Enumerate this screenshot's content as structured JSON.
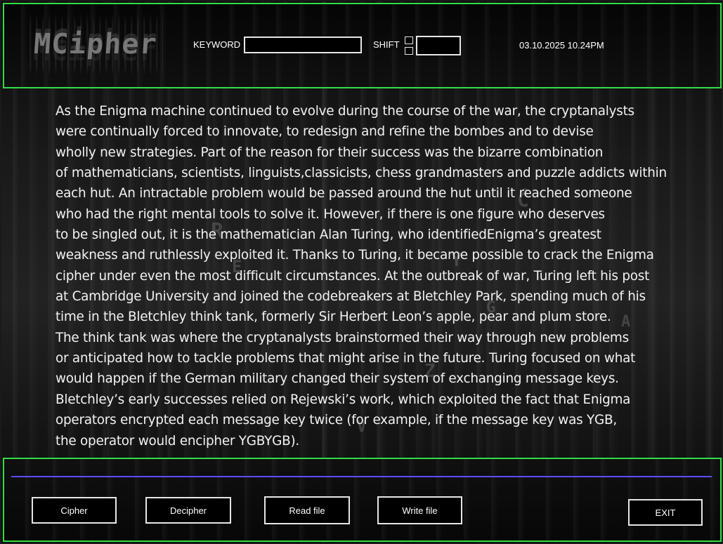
{
  "header": {
    "logo_text": "MCipher",
    "keyword_label": "KEYWORD",
    "keyword_value": "",
    "shift_label": "SHIFT",
    "shift_value": "",
    "datetime": "03.10.2025 10.24PM"
  },
  "main": {
    "lines": [
      "As the Enigma machine continued to evolve during the course of the war, the cryptanalysts",
      "were continually forced to innovate, to redesign and refine the bombes and to devise",
      "wholly new strategies. Part of the reason for their success was the bizarre combination",
      "of mathematicians, scientists, linguists,classicists, chess grandmasters and puzzle addicts within",
      "each hut. An intractable problem would be passed around the hut until it reached someone",
      "who had the right mental tools to solve it. However, if there is one figure who deserves",
      "to be singled out, it is the mathematician Alan Turing, who identifiedEnigma’s greatest",
      "weakness and ruthlessly exploited it. Thanks to Turing, it became possible to crack the Enigma",
      "cipher under even the most difficult circumstances. At the outbreak of war, Turing left his post",
      "at Cambridge University and joined the codebreakers at Bletchley Park, spending much of his",
      "time in the Bletchley think tank, formerly Sir Herbert Leon’s apple, pear and plum store.",
      "The think tank was where the cryptanalysts brainstormed their way through new problems",
      "or anticipated how to tackle problems that might arise in the future. Turing focused on what",
      "would happen if the German military changed their system of exchanging message keys.",
      "Bletchley’s early successes relied on Rejewski’s work, which exploited the fact that Enigma",
      "operators encrypted each message key twice (for example, if the message key was YGB,",
      "the operator would encipher YGBYGB)."
    ]
  },
  "footer": {
    "progress": 1.0,
    "buttons": {
      "cipher": "Cipher",
      "decipher": "Decipher",
      "read_file": "Read file",
      "write_file": "Write file",
      "exit": "EXIT"
    }
  },
  "colors": {
    "panel_border": "#33dd44",
    "progress_line": "#5a4dff",
    "background": "#000000",
    "text": "#ffffff"
  }
}
